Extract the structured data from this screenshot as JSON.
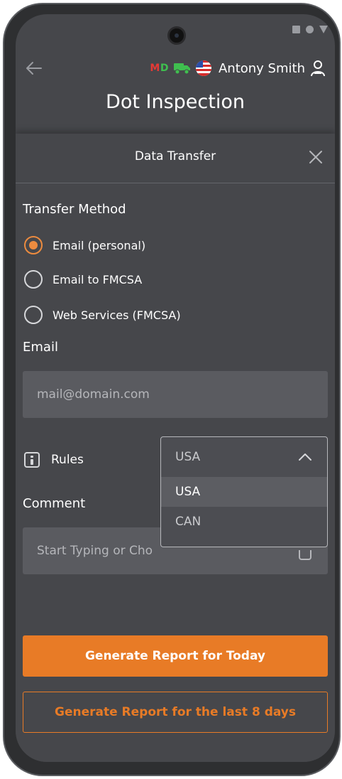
{
  "status_bar": {
    "icons": [
      "square-icon",
      "circle-icon",
      "triangle-icon"
    ]
  },
  "header": {
    "badge_m": "M",
    "badge_d": "D",
    "user_name": "Antony Smith",
    "title": "Dot Inspection"
  },
  "dialog": {
    "title": "Data Transfer",
    "transfer_method_label": "Transfer Method",
    "transfer_options": [
      {
        "label": "Email (personal)",
        "selected": true
      },
      {
        "label": "Email to FMCSA",
        "selected": false
      },
      {
        "label": "Web Services (FMCSA)",
        "selected": false
      }
    ],
    "email_label": "Email",
    "email_placeholder": "mail@domain.com",
    "rules_label": "Rules",
    "rules_selected": "USA",
    "rules_options": [
      "USA",
      "CAN"
    ],
    "comment_label": "Comment",
    "comment_placeholder": "Start Typing or Cho",
    "generate_today_label": "Generate Report for Today",
    "generate_8_days_label": "Generate Report for the last 8 days"
  },
  "colors": {
    "accent": "#e87b26",
    "background": "#46474b",
    "input": "#5a5b60"
  }
}
